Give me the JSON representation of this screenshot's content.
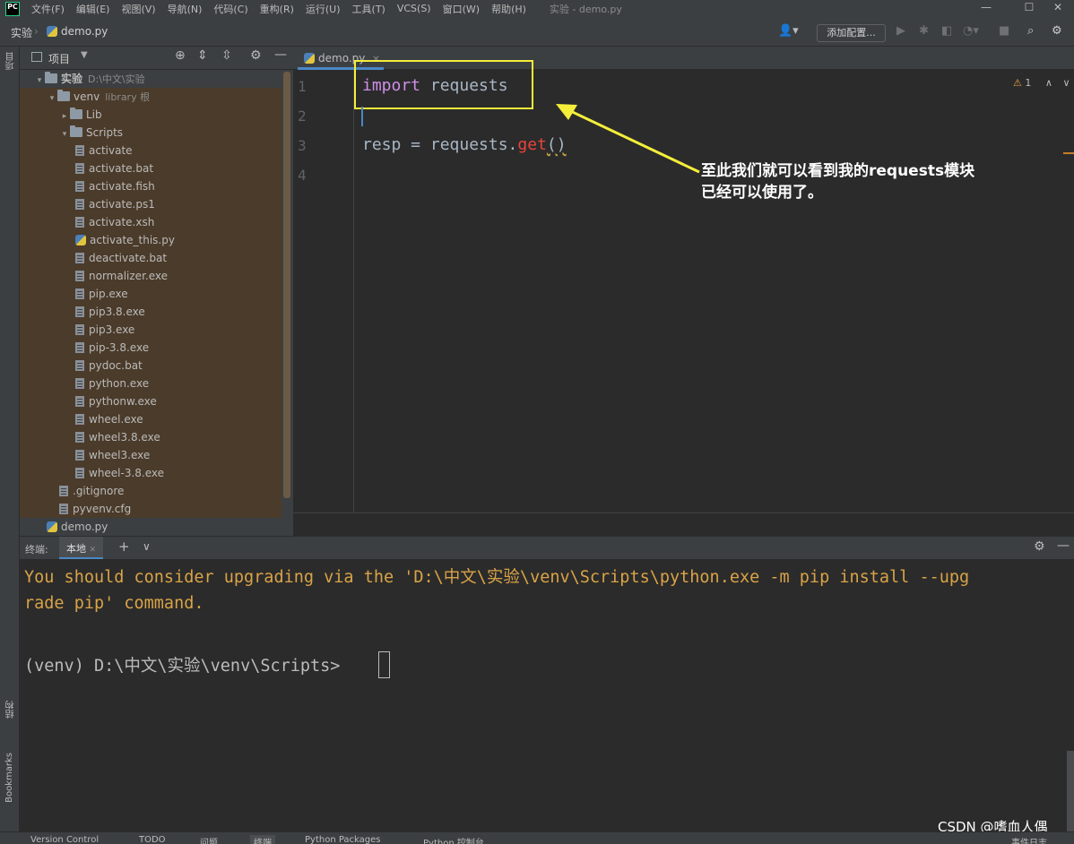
{
  "menubar": {
    "logo": "PC",
    "items": [
      "文件(F)",
      "编辑(E)",
      "视图(V)",
      "导航(N)",
      "代码(C)",
      "重构(R)",
      "运行(U)",
      "工具(T)",
      "VCS(S)",
      "窗口(W)",
      "帮助(H)"
    ],
    "window_title": "实验 - demo.py"
  },
  "navbar": {
    "breadcrumb_project": "实验",
    "breadcrumb_file": "demo.py",
    "add_config": "添加配置..."
  },
  "left_stripe": {
    "project": "项目",
    "structure": "结构",
    "bookmarks": "Bookmarks"
  },
  "project_panel": {
    "title": "项目"
  },
  "tree": [
    {
      "label": "实验",
      "extra": "D:\\中文\\实验",
      "kind": "folder",
      "depth": 0,
      "open": true
    },
    {
      "label": "venv",
      "extra": "library 根",
      "kind": "folder",
      "depth": 1,
      "open": true
    },
    {
      "label": "Lib",
      "extra": "",
      "kind": "folder",
      "depth": 2,
      "open": false
    },
    {
      "label": "Scripts",
      "extra": "",
      "kind": "folder",
      "depth": 2,
      "open": true
    },
    {
      "label": "activate",
      "extra": "",
      "kind": "file",
      "depth": 3
    },
    {
      "label": "activate.bat",
      "extra": "",
      "kind": "file",
      "depth": 3
    },
    {
      "label": "activate.fish",
      "extra": "",
      "kind": "file",
      "depth": 3
    },
    {
      "label": "activate.ps1",
      "extra": "",
      "kind": "file",
      "depth": 3
    },
    {
      "label": "activate.xsh",
      "extra": "",
      "kind": "file",
      "depth": 3
    },
    {
      "label": "activate_this.py",
      "extra": "",
      "kind": "py",
      "depth": 3
    },
    {
      "label": "deactivate.bat",
      "extra": "",
      "kind": "file",
      "depth": 3
    },
    {
      "label": "normalizer.exe",
      "extra": "",
      "kind": "file",
      "depth": 3
    },
    {
      "label": "pip.exe",
      "extra": "",
      "kind": "file",
      "depth": 3
    },
    {
      "label": "pip3.8.exe",
      "extra": "",
      "kind": "file",
      "depth": 3
    },
    {
      "label": "pip3.exe",
      "extra": "",
      "kind": "file",
      "depth": 3
    },
    {
      "label": "pip-3.8.exe",
      "extra": "",
      "kind": "file",
      "depth": 3
    },
    {
      "label": "pydoc.bat",
      "extra": "",
      "kind": "file",
      "depth": 3
    },
    {
      "label": "python.exe",
      "extra": "",
      "kind": "file",
      "depth": 3
    },
    {
      "label": "pythonw.exe",
      "extra": "",
      "kind": "file",
      "depth": 3
    },
    {
      "label": "wheel.exe",
      "extra": "",
      "kind": "file",
      "depth": 3
    },
    {
      "label": "wheel3.8.exe",
      "extra": "",
      "kind": "file",
      "depth": 3
    },
    {
      "label": "wheel3.exe",
      "extra": "",
      "kind": "file",
      "depth": 3
    },
    {
      "label": "wheel-3.8.exe",
      "extra": "",
      "kind": "file",
      "depth": 3
    },
    {
      "label": ".gitignore",
      "extra": "",
      "kind": "file",
      "depth": 2
    },
    {
      "label": "pyvenv.cfg",
      "extra": "",
      "kind": "file",
      "depth": 2
    },
    {
      "label": "demo.py",
      "extra": "",
      "kind": "py",
      "depth": 1
    }
  ],
  "editor": {
    "tab": "demo.py",
    "line_numbers": [
      "1",
      "2",
      "3",
      "4"
    ],
    "line1_kw": "import",
    "line1_rest": " requests",
    "line3_a": "resp = requests.",
    "line3_fn": "get",
    "line3_b": "()",
    "warnings": "1"
  },
  "annotation": {
    "line1": "至此我们就可以看到我的requests模块",
    "line2": "已经可以使用了。",
    "color": "#f4ee3a"
  },
  "terminal": {
    "label": "终端:",
    "tab": "本地",
    "line1": "You should consider upgrading via the 'D:\\中文\\实验\\venv\\Scripts\\python.exe -m pip install --upg",
    "line2": "rade pip' command.",
    "prompt": "(venv) D:\\中文\\实验\\venv\\Scripts>"
  },
  "statusbar": {
    "items": [
      "Version Control",
      "TODO",
      "问题",
      "终端",
      "Python Packages",
      "Python 控制台"
    ],
    "right": "事件日志"
  },
  "watermark": "CSDN @嗜血人偶"
}
